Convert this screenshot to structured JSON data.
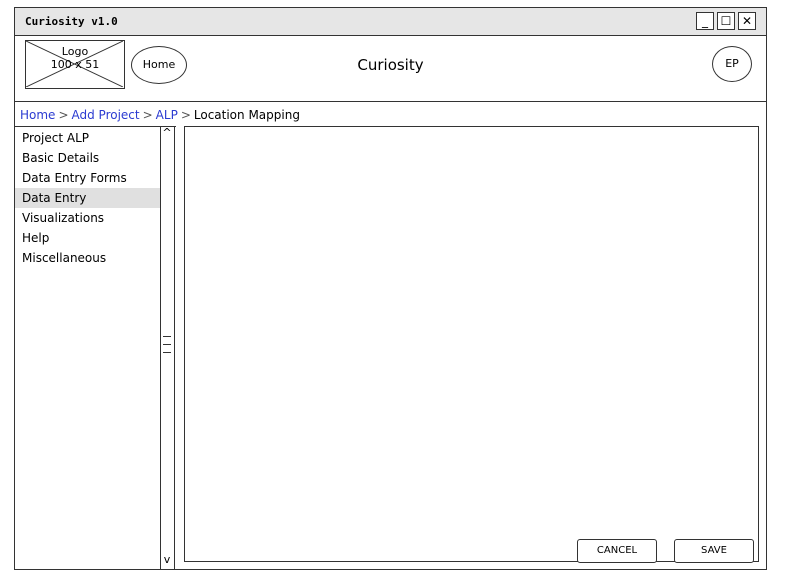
{
  "window": {
    "title": "Curiosity v1.0",
    "controls": {
      "minimize": "_",
      "maximize": "☐",
      "close": "✕"
    }
  },
  "header": {
    "logo_label": "Logo",
    "logo_size": "100 x 51",
    "home_button": "Home",
    "app_name": "Curiosity",
    "user_initials": "EP"
  },
  "breadcrumb": {
    "items": [
      "Home",
      "Add Project",
      "ALP"
    ],
    "current": "Location Mapping",
    "separator": ">"
  },
  "sidebar": {
    "items": [
      {
        "label": "Project ALP"
      },
      {
        "label": "Basic Details"
      },
      {
        "label": "Data Entry Forms"
      },
      {
        "label": "Data Entry",
        "active": true
      },
      {
        "label": "Visualizations"
      },
      {
        "label": "Help"
      },
      {
        "label": "Miscellaneous"
      }
    ]
  },
  "actions": {
    "cancel": "CANCEL",
    "save": "SAVE"
  }
}
